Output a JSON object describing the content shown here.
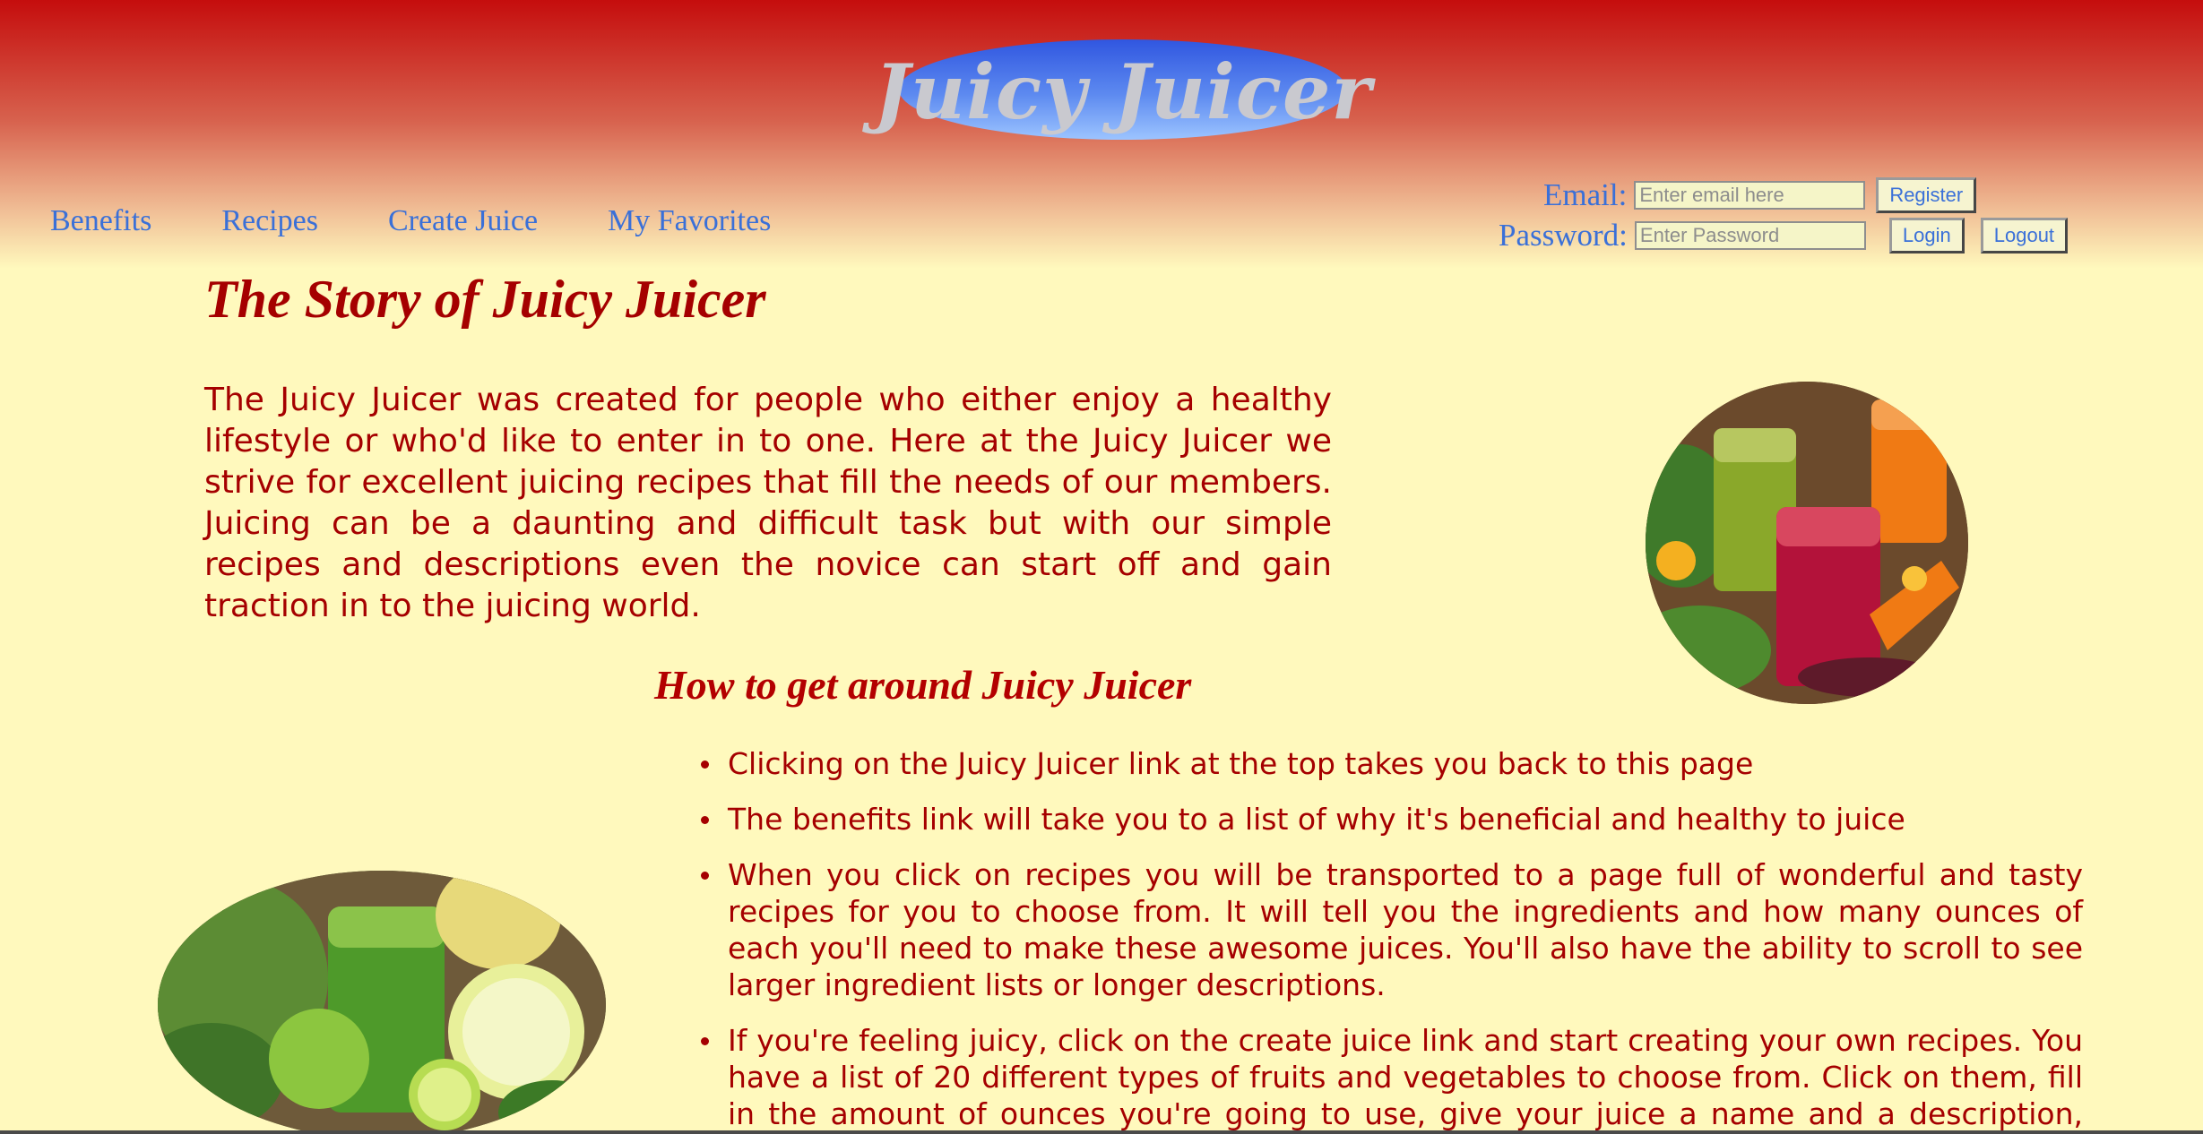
{
  "header": {
    "logo_text": "Juicy Juicer"
  },
  "nav": {
    "items": [
      {
        "label": "Benefits"
      },
      {
        "label": "Recipes"
      },
      {
        "label": "Create Juice"
      },
      {
        "label": "My Favorites"
      }
    ]
  },
  "login": {
    "email_label": "Email:",
    "email_placeholder": "Enter email here",
    "password_label": "Password:",
    "password_placeholder": "Enter Password",
    "register_label": "Register",
    "login_label": "Login",
    "logout_label": "Logout"
  },
  "story": {
    "title": "The Story of Juicy Juicer",
    "text": "The Juicy Juicer was created for people who either enjoy a healthy lifestyle or who'd like to enter in to one. Here at the Juicy Juicer we strive for excellent juicing recipes that fill the needs of our members. Juicing can be a daunting and difficult task but with our simple recipes and descriptions even the novice can start off and gain traction in to the juicing world."
  },
  "howto": {
    "title": "How to get around Juicy Juicer",
    "items": [
      "Clicking on the Juicy Juicer link at the top takes you back to this page",
      "The benefits link will take you to a list of why it's beneficial and healthy to juice",
      "When you click on recipes you will be transported to a page full of wonderful and tasty recipes for you to choose from. It will tell you the ingredients and how many ounces of each you'll need to make these awesome juices. You'll also have the ability to scroll to see larger ingredient lists or longer descriptions.",
      "If you're feeling juicy, click on the create juice link and start creating your own recipes. You have a list of 20 different types of fruits and vegetables to choose from. Click on them, fill in the amount of ounces you're going to use, give your juice a name and a description, click add to favorites and"
    ]
  },
  "images": {
    "juice_glasses": "juice-glasses-photo",
    "green_smoothie": "green-smoothie-photo"
  }
}
